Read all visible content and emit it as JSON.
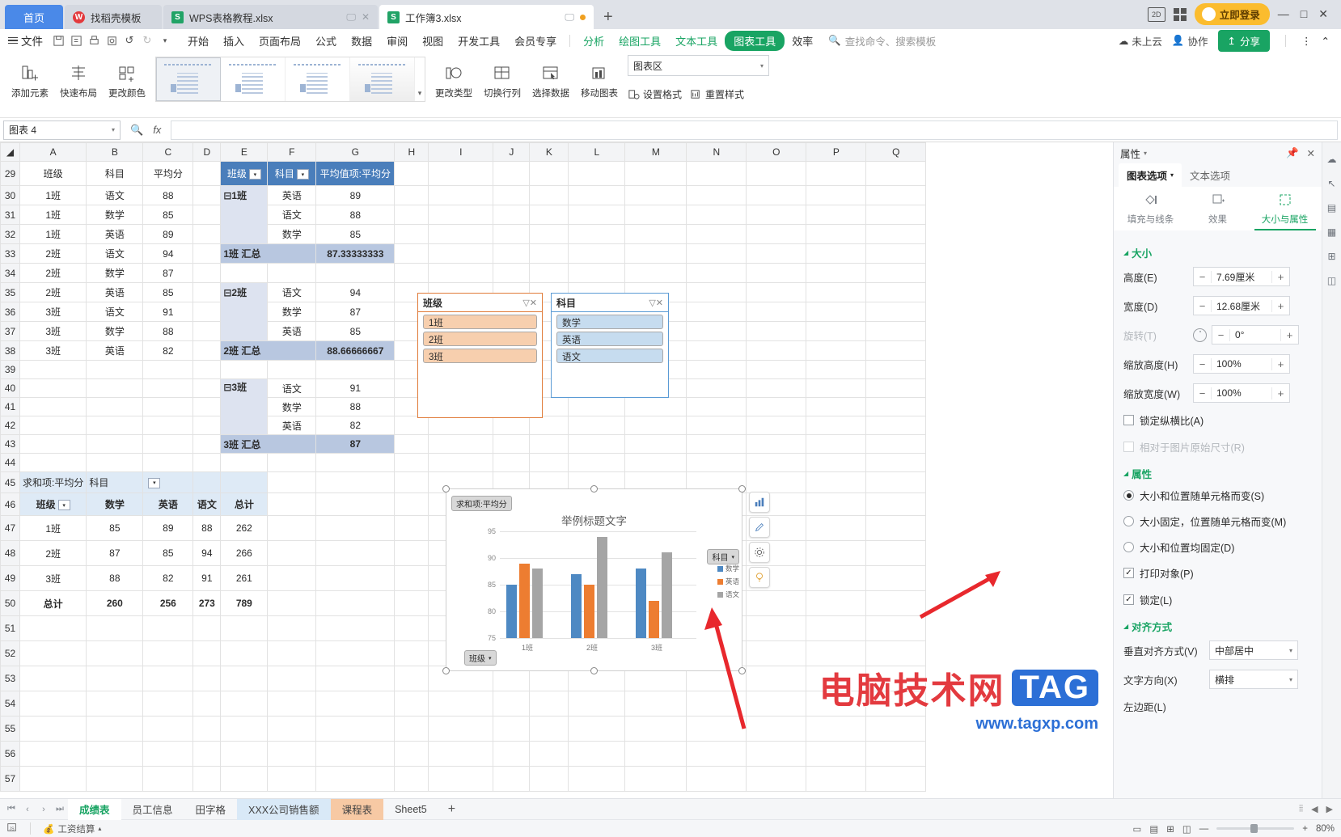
{
  "window": {
    "doc_tabs": [
      {
        "label": "首页",
        "kind": "home"
      },
      {
        "label": "找稻壳模板",
        "kind": "template",
        "icon": "docer-icon"
      },
      {
        "label": "WPS表格教程.xlsx",
        "kind": "file",
        "icon": "sheet-icon"
      },
      {
        "label": "工作簿3.xlsx",
        "kind": "file",
        "icon": "sheet-icon",
        "active": true
      }
    ],
    "new_tab": "+",
    "login_label": "立即登录",
    "min": "—",
    "max": "□",
    "close": "✕"
  },
  "menu": {
    "file": "文件",
    "quick": [
      "save-icon",
      "save-as-icon",
      "print-icon",
      "print-preview-icon",
      "undo-icon",
      "redo-icon",
      "customize-icon"
    ],
    "items": [
      {
        "label": "开始"
      },
      {
        "label": "插入"
      },
      {
        "label": "页面布局"
      },
      {
        "label": "公式"
      },
      {
        "label": "数据"
      },
      {
        "label": "审阅"
      },
      {
        "label": "视图"
      },
      {
        "label": "开发工具"
      },
      {
        "label": "会员专享"
      }
    ],
    "contextual": [
      {
        "label": "分析",
        "style": "green"
      },
      {
        "label": "绘图工具",
        "style": "green"
      },
      {
        "label": "文本工具",
        "style": "green"
      },
      {
        "label": "图表工具",
        "style": "pill"
      },
      {
        "label": "效率",
        "style": "plain"
      }
    ],
    "search_placeholder": "查找命令、搜索模板",
    "cloud_status": "未上云",
    "collab": "协作",
    "share": "分享"
  },
  "ribbon": {
    "buttons": [
      {
        "label": "添加元素",
        "icon": "add-element-icon",
        "dropdown": true
      },
      {
        "label": "快速布局",
        "icon": "quick-layout-icon",
        "dropdown": true
      },
      {
        "label": "更改颜色",
        "icon": "change-color-icon",
        "dropdown": true
      }
    ],
    "gallery_count": 4,
    "gallery_selected": 0,
    "right_buttons": [
      {
        "label": "更改类型",
        "icon": "change-type-icon"
      },
      {
        "label": "切换行列",
        "icon": "switch-row-col-icon"
      },
      {
        "label": "选择数据",
        "icon": "select-data-icon"
      },
      {
        "label": "移动图表",
        "icon": "move-chart-icon"
      }
    ],
    "element_select": "图表区",
    "format_label": "设置格式",
    "reset_label": "重置样式"
  },
  "formula_bar": {
    "name_box": "图表 4",
    "formula_value": "",
    "fx": "fx"
  },
  "sheet": {
    "col_headers": [
      "A",
      "B",
      "C",
      "D",
      "E",
      "F",
      "G",
      "H",
      "I",
      "J",
      "K",
      "L",
      "M",
      "N",
      "O",
      "P",
      "Q"
    ],
    "row_numbers": [
      29,
      30,
      31,
      32,
      33,
      34,
      35,
      36,
      37,
      38,
      39,
      40,
      41,
      42,
      43,
      44,
      45,
      46,
      47,
      48,
      49,
      50,
      51,
      52,
      53,
      54,
      55,
      56,
      57
    ],
    "source_table": {
      "headers": [
        "班级",
        "科目",
        "平均分"
      ],
      "rows": [
        [
          "1班",
          "语文",
          "88"
        ],
        [
          "1班",
          "数学",
          "85"
        ],
        [
          "1班",
          "英语",
          "89"
        ],
        [
          "2班",
          "语文",
          "94"
        ],
        [
          "2班",
          "数学",
          "87"
        ],
        [
          "2班",
          "英语",
          "85"
        ],
        [
          "3班",
          "语文",
          "91"
        ],
        [
          "3班",
          "数学",
          "88"
        ],
        [
          "3班",
          "英语",
          "82"
        ]
      ]
    },
    "pivot1": {
      "headers": [
        "班级",
        "科目",
        "平均值项:平均分"
      ],
      "groups": [
        {
          "name": "1班",
          "rows": [
            [
              "英语",
              "89"
            ],
            [
              "语文",
              "88"
            ],
            [
              "数学",
              "85"
            ]
          ],
          "total_label": "1班 汇总",
          "total": "87.33333333"
        },
        {
          "name": "2班",
          "rows": [
            [
              "语文",
              "94"
            ],
            [
              "数学",
              "87"
            ],
            [
              "英语",
              "85"
            ]
          ],
          "total_label": "2班 汇总",
          "total": "88.66666667"
        },
        {
          "name": "3班",
          "rows": [
            [
              "语文",
              "91"
            ],
            [
              "数学",
              "88"
            ],
            [
              "英语",
              "82"
            ]
          ],
          "total_label": "3班 汇总",
          "total": "87"
        }
      ]
    },
    "pivot2": {
      "corner": "求和项:平均分",
      "col_field": "科目",
      "row_field": "班级",
      "columns": [
        "数学",
        "英语",
        "语文",
        "总计"
      ],
      "rows": [
        {
          "label": "1班",
          "values": [
            "85",
            "89",
            "88",
            "262"
          ]
        },
        {
          "label": "2班",
          "values": [
            "87",
            "85",
            "94",
            "266"
          ]
        },
        {
          "label": "3班",
          "values": [
            "88",
            "82",
            "91",
            "261"
          ]
        }
      ],
      "total_label": "总计",
      "totals": [
        "260",
        "256",
        "273",
        "789"
      ]
    },
    "slicers": [
      {
        "title": "班级",
        "items": [
          "1班",
          "2班",
          "3班"
        ],
        "accent": "#e07b39"
      },
      {
        "title": "科目",
        "items": [
          "数学",
          "英语",
          "语文"
        ],
        "accent": "#5b9bd5"
      }
    ]
  },
  "chart_data": {
    "type": "bar",
    "title": "举例标题文字",
    "value_field_label": "求和项:平均分",
    "category_field_label": "班级",
    "legend_title": "科目",
    "categories": [
      "1班",
      "2班",
      "3班"
    ],
    "series": [
      {
        "name": "数学",
        "color": "#4e89c3",
        "values": [
          85,
          87,
          88
        ]
      },
      {
        "name": "英语",
        "color": "#ed7d31",
        "values": [
          89,
          85,
          82
        ]
      },
      {
        "name": "语文",
        "color": "#a5a5a5",
        "values": [
          88,
          94,
          91
        ]
      }
    ],
    "yticks": [
      75,
      80,
      85,
      90,
      95
    ],
    "ylim": [
      75,
      96
    ],
    "xlabel": "",
    "ylabel": "",
    "grid": true,
    "legend_position": "right"
  },
  "chart_tools": [
    {
      "name": "chart-elements-icon",
      "glyph": "chart"
    },
    {
      "name": "chart-style-icon",
      "glyph": "pen"
    },
    {
      "name": "chart-format-icon",
      "glyph": "gear"
    },
    {
      "name": "chart-ideas-icon",
      "glyph": "bulb"
    }
  ],
  "right_panel": {
    "title": "属性",
    "pin_icon": "pin-icon",
    "close_icon": "close-icon",
    "tabs": [
      {
        "label": "图表选项",
        "active": true,
        "dropdown": true
      },
      {
        "label": "文本选项",
        "active": false
      }
    ],
    "subtabs": [
      {
        "label": "填充与线条",
        "icon": "fill-line-icon",
        "active": false
      },
      {
        "label": "效果",
        "icon": "effects-icon",
        "active": false
      },
      {
        "label": "大小与属性",
        "icon": "size-properties-icon",
        "active": true
      }
    ],
    "size_section": "大小",
    "fields": [
      {
        "label": "高度(E)",
        "value": "7.69厘米",
        "dim": false
      },
      {
        "label": "宽度(D)",
        "value": "12.68厘米",
        "dim": false
      },
      {
        "label": "旋转(T)",
        "value": "0°",
        "dim": true,
        "knob": true
      },
      {
        "label": "缩放高度(H)",
        "value": "100%",
        "dim": false
      },
      {
        "label": "缩放宽度(W)",
        "value": "100%",
        "dim": false
      }
    ],
    "checkboxes_size": [
      {
        "label": "锁定纵横比(A)",
        "checked": false,
        "dim": false
      },
      {
        "label": "相对于图片原始尺寸(R)",
        "checked": false,
        "dim": true
      }
    ],
    "props_section": "属性",
    "radios": [
      {
        "label": "大小和位置随单元格而变(S)",
        "checked": true
      },
      {
        "label": "大小固定，位置随单元格而变(M)",
        "checked": false
      },
      {
        "label": "大小和位置均固定(D)",
        "checked": false
      }
    ],
    "checkboxes_props": [
      {
        "label": "打印对象(P)",
        "checked": true
      },
      {
        "label": "锁定(L)",
        "checked": true
      }
    ],
    "align_section": "对齐方式",
    "align_fields": [
      {
        "label": "垂直对齐方式(V)",
        "value": "中部居中"
      },
      {
        "label": "文字方向(X)",
        "value": "横排"
      },
      {
        "label": "左边距(L)",
        "value": ""
      }
    ]
  },
  "rail_icons": [
    "cloud-icon",
    "cursor-icon",
    "layers-icon",
    "picture-icon",
    "table-icon",
    "shapes-icon"
  ],
  "sheet_tabs": {
    "nav": [
      "⏮",
      "‹",
      "›",
      "⏭"
    ],
    "tabs": [
      {
        "label": "成绩表",
        "active": true,
        "color": "none"
      },
      {
        "label": "员工信息",
        "active": false,
        "color": "none"
      },
      {
        "label": "田字格",
        "active": false,
        "color": "none"
      },
      {
        "label": "XXX公司销售额",
        "active": false,
        "color": "blue"
      },
      {
        "label": "课程表",
        "active": false,
        "color": "orange"
      },
      {
        "label": "Sheet5",
        "active": false,
        "color": "none"
      }
    ],
    "add": "+"
  },
  "status_bar": {
    "left_items": [
      "工资结算"
    ],
    "zoom": "80%",
    "minus": "—",
    "plus": "+",
    "view_modes": [
      "normal-view-icon",
      "page-layout-icon",
      "page-break-icon",
      "reading-icon"
    ]
  },
  "watermark": {
    "cn": "电脑技术网",
    "tag": "TAG",
    "url": "www.tagxp.com"
  }
}
